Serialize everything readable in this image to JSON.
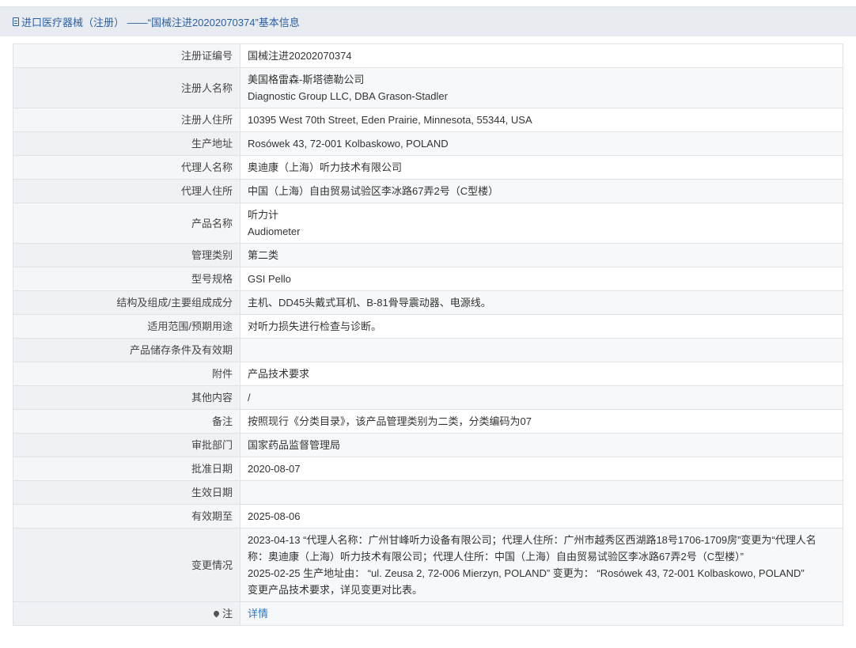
{
  "header": {
    "title": "进口医疗器械（注册） ——“国械注进20202070374”基本信息"
  },
  "rows": [
    {
      "label": "注册证编号",
      "lines": [
        "国械注进20202070374"
      ]
    },
    {
      "label": "注册人名称",
      "lines": [
        "美国格雷森-斯塔德勒公司",
        "Diagnostic Group LLC, DBA Grason-Stadler"
      ]
    },
    {
      "label": "注册人住所",
      "lines": [
        "10395 West 70th Street, Eden Prairie, Minnesota, 55344, USA"
      ]
    },
    {
      "label": "生产地址",
      "lines": [
        "Rosówek 43, 72-001 Kolbaskowo, POLAND"
      ]
    },
    {
      "label": "代理人名称",
      "lines": [
        "奥迪康（上海）听力技术有限公司"
      ]
    },
    {
      "label": "代理人住所",
      "lines": [
        "中国（上海）自由贸易试验区李冰路67弄2号（C型楼）"
      ]
    },
    {
      "label": "产品名称",
      "lines": [
        "听力计",
        "Audiometer"
      ]
    },
    {
      "label": "管理类别",
      "lines": [
        "第二类"
      ]
    },
    {
      "label": "型号规格",
      "lines": [
        "GSI Pello"
      ]
    },
    {
      "label": "结构及组成/主要组成成分",
      "lines": [
        "主机、DD45头戴式耳机、B-81骨导震动器、电源线。"
      ]
    },
    {
      "label": "适用范围/预期用途",
      "lines": [
        "对听力损失进行检查与诊断。"
      ]
    },
    {
      "label": "产品储存条件及有效期",
      "lines": [
        ""
      ]
    },
    {
      "label": "附件",
      "lines": [
        "产品技术要求"
      ]
    },
    {
      "label": "其他内容",
      "lines": [
        "/"
      ]
    },
    {
      "label": "备注",
      "lines": [
        "按照现行《分类目录》，该产品管理类别为二类，分类编码为07"
      ]
    },
    {
      "label": "审批部门",
      "lines": [
        "国家药品监督管理局"
      ]
    },
    {
      "label": "批准日期",
      "lines": [
        "2020-08-07"
      ]
    },
    {
      "label": "生效日期",
      "lines": [
        ""
      ]
    },
    {
      "label": "有效期至",
      "lines": [
        "2025-08-06"
      ]
    },
    {
      "label": "变更情况",
      "lines": [
        "2023-04-13 “代理人名称：广州甘峰听力设备有限公司；代理人住所：广州市越秀区西湖路18号1706-1709房”变更为“代理人名",
        "称：奥迪康（上海）听力技术有限公司；代理人住所：中国（上海）自由贸易试验区李冰路67弄2号（C型楼）”",
        "2025-02-25 生产地址由： “ul. Zeusa 2, 72-006 Mierzyn, POLAND” 变更为： “Rosówek 43, 72-001 Kolbaskowo, POLAND”",
        "变更产品技术要求，详见变更对比表。"
      ]
    }
  ],
  "note": {
    "label": "注",
    "icon": "pin-icon",
    "link_text": "详情"
  }
}
